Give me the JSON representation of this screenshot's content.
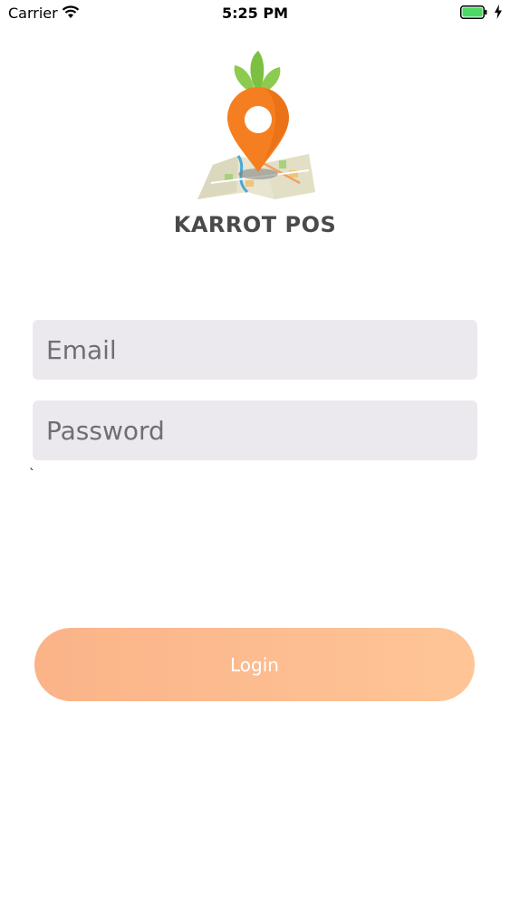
{
  "status_bar": {
    "carrier": "Carrier",
    "time": "5:25 PM",
    "wifi_icon": "wifi-icon",
    "battery_icon": "battery-icon",
    "charging_icon": "charging-bolt-icon"
  },
  "brand": {
    "logo_icon": "carrot-map-pin-icon",
    "name": "KARROT POS"
  },
  "form": {
    "email_placeholder": "Email",
    "email_value": "",
    "password_placeholder": "Password",
    "password_value": "",
    "stray_mark": "`"
  },
  "actions": {
    "login_label": "Login"
  },
  "colors": {
    "accent_start": "#fbb388",
    "accent_end": "#fec597",
    "field_bg": "#ebe9ee",
    "brand_text": "#4a4a4a",
    "battery": "#4cd964"
  }
}
